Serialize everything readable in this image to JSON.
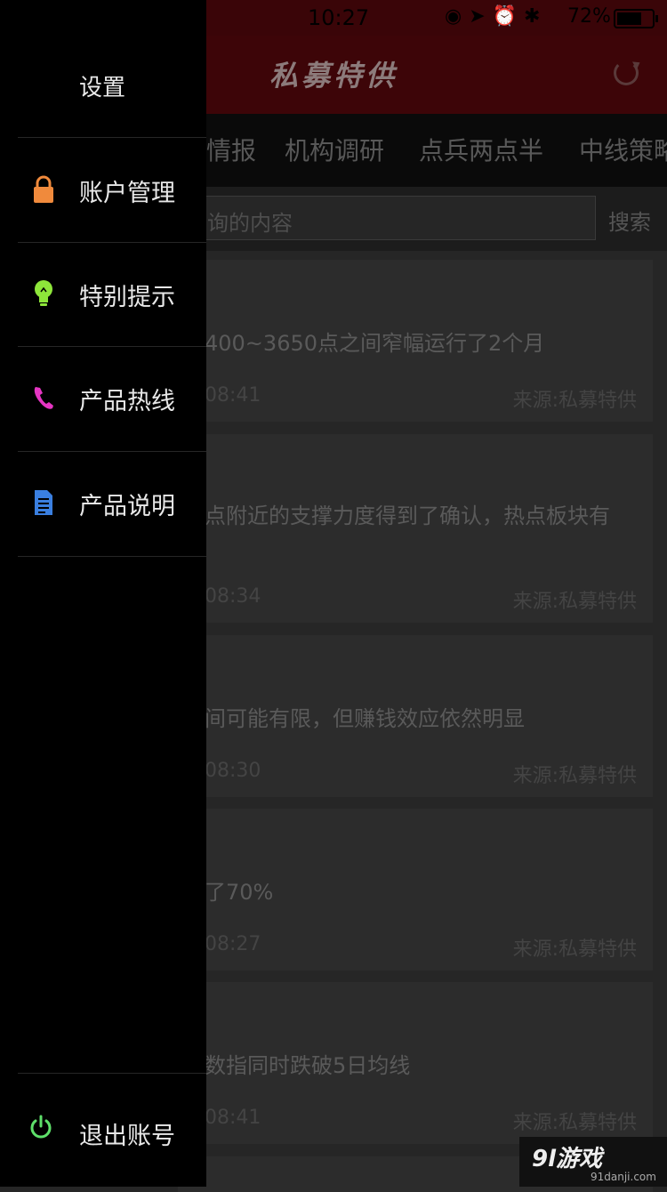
{
  "status_bar": {
    "time": "10:27",
    "battery_percent": "72%",
    "battery_level": 0.72
  },
  "header": {
    "title": "私募特供"
  },
  "tabs": [
    {
      "label": "情报"
    },
    {
      "label": "机构调研"
    },
    {
      "label": "点兵两点半"
    },
    {
      "label": "中线策略"
    }
  ],
  "search": {
    "placeholder": "询的内容",
    "button_label": "搜索"
  },
  "articles": [
    {
      "line1": "400~3650点之间窄幅运行了2个月",
      "line2": "",
      "time": "08:41",
      "source": "来源:私募特供"
    },
    {
      "line1": "点附近的支撑力度得到了确认，热点板块有",
      "line2": "",
      "time": "08:34",
      "source": "来源:私募特供"
    },
    {
      "line1": "间可能有限，但赚钱效应依然明显",
      "line2": "",
      "time": "08:30",
      "source": "来源:私募特供"
    },
    {
      "line1": "了70%",
      "line2": "",
      "time": "08:27",
      "source": "来源:私募特供"
    },
    {
      "line1": "数指同时跌破5日均线",
      "line2": "",
      "time": "08:41",
      "source": "来源:私募特供"
    }
  ],
  "drawer": {
    "title": "设置",
    "items": [
      {
        "label": "账户管理",
        "icon": "lock-icon",
        "color": "#f08a3c"
      },
      {
        "label": "特别提示",
        "icon": "lightbulb-icon",
        "color": "#8ee63a"
      },
      {
        "label": "产品热线",
        "icon": "phone-icon",
        "color": "#e535c2"
      },
      {
        "label": "产品说明",
        "icon": "document-icon",
        "color": "#3a7fe0"
      }
    ],
    "logout": {
      "label": "退出账号",
      "icon": "power-icon",
      "color": "#5ee06a"
    }
  },
  "watermark": {
    "brand": "9l游戏",
    "domain": "91danji.com"
  }
}
